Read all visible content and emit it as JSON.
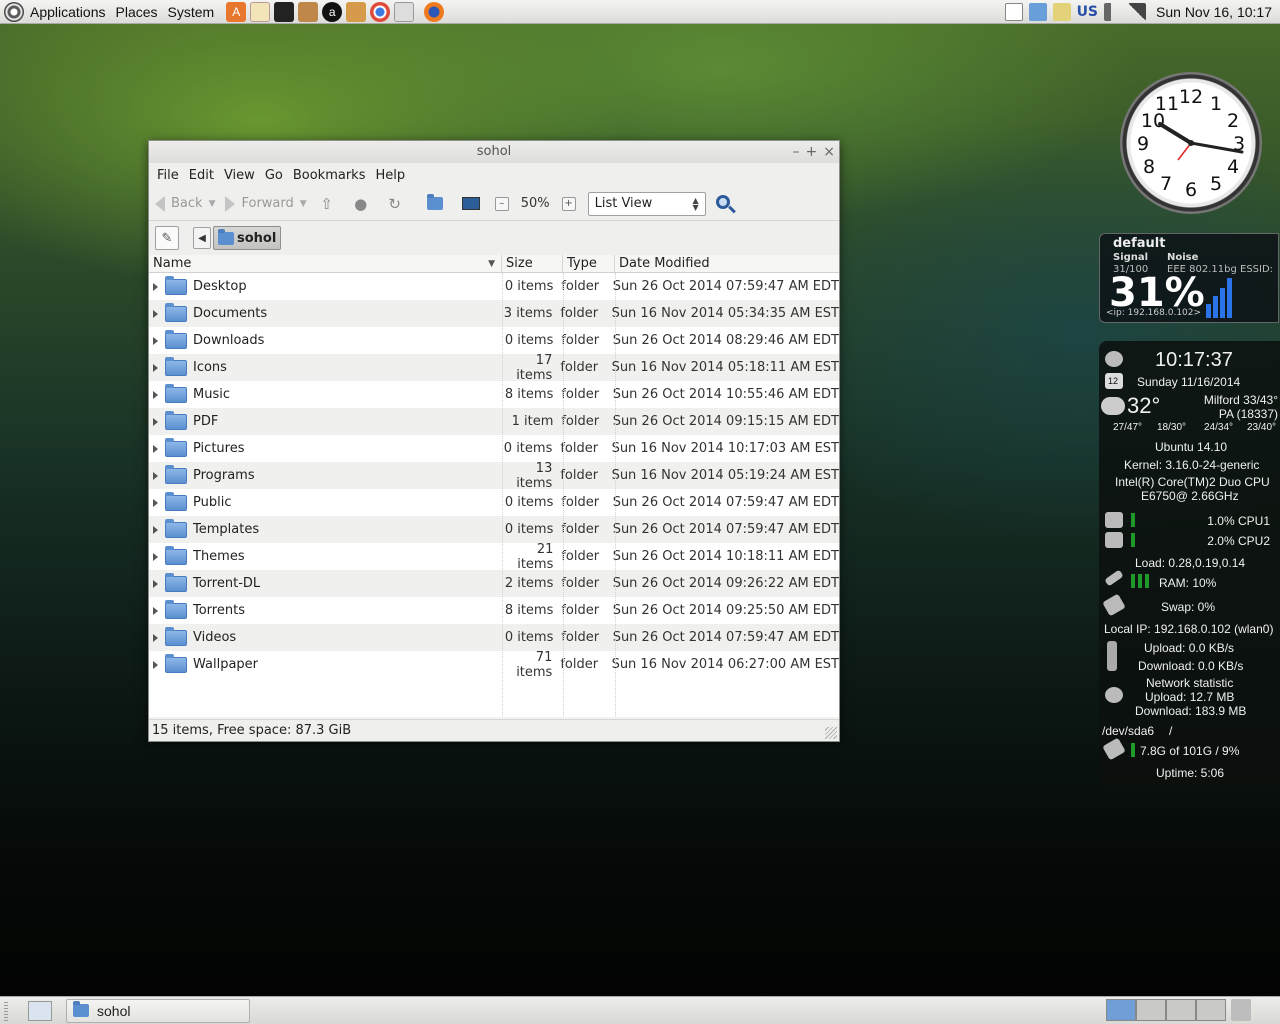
{
  "top_panel": {
    "menus": [
      "Applications",
      "Places",
      "System"
    ],
    "keyboard_layout": "US",
    "clock": "Sun Nov 16, 10:17"
  },
  "window": {
    "title": "sohol",
    "menu": [
      "File",
      "Edit",
      "View",
      "Go",
      "Bookmarks",
      "Help"
    ],
    "toolbar": {
      "back_label": "Back",
      "forward_label": "Forward",
      "zoom": "50%",
      "view_mode": "List View"
    },
    "breadcrumb": "sohol",
    "columns": {
      "name": "Name",
      "size": "Size",
      "type": "Type",
      "date": "Date Modified"
    },
    "rows": [
      {
        "name": "Desktop",
        "size": "0 items",
        "type": "folder",
        "date": "Sun 26 Oct 2014 07:59:47 AM EDT"
      },
      {
        "name": "Documents",
        "size": "3 items",
        "type": "folder",
        "date": "Sun 16 Nov 2014 05:34:35 AM EST"
      },
      {
        "name": "Downloads",
        "size": "0 items",
        "type": "folder",
        "date": "Sun 26 Oct 2014 08:29:46 AM EDT"
      },
      {
        "name": "Icons",
        "size": "17 items",
        "type": "folder",
        "date": "Sun 16 Nov 2014 05:18:11 AM EST"
      },
      {
        "name": "Music",
        "size": "8 items",
        "type": "folder",
        "date": "Sun 26 Oct 2014 10:55:46 AM EDT"
      },
      {
        "name": "PDF",
        "size": "1 item",
        "type": "folder",
        "date": "Sun 26 Oct 2014 09:15:15 AM EDT"
      },
      {
        "name": "Pictures",
        "size": "0 items",
        "type": "folder",
        "date": "Sun 16 Nov 2014 10:17:03 AM EST"
      },
      {
        "name": "Programs",
        "size": "13 items",
        "type": "folder",
        "date": "Sun 16 Nov 2014 05:19:24 AM EST"
      },
      {
        "name": "Public",
        "size": "0 items",
        "type": "folder",
        "date": "Sun 26 Oct 2014 07:59:47 AM EDT"
      },
      {
        "name": "Templates",
        "size": "0 items",
        "type": "folder",
        "date": "Sun 26 Oct 2014 07:59:47 AM EDT"
      },
      {
        "name": "Themes",
        "size": "21 items",
        "type": "folder",
        "date": "Sun 26 Oct 2014 10:18:11 AM EDT"
      },
      {
        "name": "Torrent-DL",
        "size": "2 items",
        "type": "folder",
        "date": "Sun 26 Oct 2014 09:26:22 AM EDT"
      },
      {
        "name": "Torrents",
        "size": "8 items",
        "type": "folder",
        "date": "Sun 26 Oct 2014 09:25:50 AM EDT"
      },
      {
        "name": "Videos",
        "size": "0 items",
        "type": "folder",
        "date": "Sun 26 Oct 2014 07:59:47 AM EDT"
      },
      {
        "name": "Wallpaper",
        "size": "71 items",
        "type": "folder",
        "date": "Sun 16 Nov 2014 06:27:00 AM EST"
      }
    ],
    "status": "15 items, Free space: 87.3 GiB"
  },
  "wifi_widget": {
    "profile": "default",
    "signal_label": "Signal",
    "noise_label": "Noise",
    "signal_value": "31/100",
    "noise_value": "EEE 802.11bg  ESSID:",
    "percent": "31%",
    "ip": "<ip: 192.168.0.102>"
  },
  "conky": {
    "time": "10:17:37",
    "date": "Sunday 11/16/2014",
    "calendar_day": "12",
    "temp": "32°",
    "location_line1": "Milford 33/43°",
    "location_line2": "PA (18337)",
    "forecast": [
      "27/47°",
      "18/30°",
      "24/34°",
      "23/40°"
    ],
    "os": "Ubuntu 14.10",
    "kernel": "Kernel: 3.16.0-24-generic",
    "cpu_model_1": "Intel(R) Core(TM)2 Duo CPU",
    "cpu_model_2": "E6750@ 2.66GHz",
    "cpu1": "1.0% CPU1",
    "cpu2": "2.0% CPU2",
    "load": "Load: 0.28,0.19,0.14",
    "ram": "RAM: 10%",
    "swap": "Swap: 0%",
    "local_ip": "Local IP: 192.168.0.102 (wlan0)",
    "upload_rate": "Upload: 0.0 KB/s",
    "download_rate": "Download: 0.0 KB/s",
    "net_stat_title": "Network statistic",
    "net_upload": "Upload: 12.7 MB",
    "net_download": "Download: 183.9 MB",
    "disk_dev": "/dev/sda6",
    "disk_mount": "/",
    "disk_usage": "7.8G of 101G / 9%",
    "uptime": "Uptime: 5:06"
  },
  "bottom_panel": {
    "task": "sohol"
  }
}
